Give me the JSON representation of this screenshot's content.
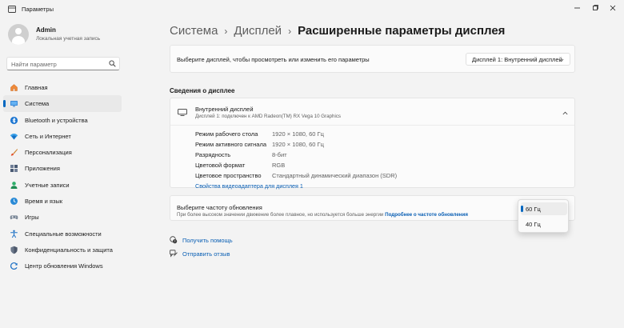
{
  "window": {
    "title": "Параметры",
    "icons": [
      "app-back-icon",
      "minimize-icon",
      "maximize-icon",
      "close-icon"
    ]
  },
  "user": {
    "name": "Admin",
    "account_type": "Локальная учетная запись"
  },
  "search": {
    "placeholder": "Найти параметр"
  },
  "sidebar": {
    "items": [
      {
        "label": "Главная",
        "icon": "home-icon"
      },
      {
        "label": "Система",
        "icon": "system-icon"
      },
      {
        "label": "Bluetooth и устройства",
        "icon": "bluetooth-icon"
      },
      {
        "label": "Сеть и Интернет",
        "icon": "network-icon"
      },
      {
        "label": "Персонализация",
        "icon": "brush-icon"
      },
      {
        "label": "Приложения",
        "icon": "apps-icon"
      },
      {
        "label": "Учетные записи",
        "icon": "accounts-icon"
      },
      {
        "label": "Время и язык",
        "icon": "globe-clock-icon"
      },
      {
        "label": "Игры",
        "icon": "gamepad-icon"
      },
      {
        "label": "Специальные возможности",
        "icon": "accessibility-icon"
      },
      {
        "label": "Конфиденциальность и защита",
        "icon": "shield-icon"
      },
      {
        "label": "Центр обновления Windows",
        "icon": "update-icon"
      }
    ],
    "selected": "Система"
  },
  "breadcrumb": {
    "items": [
      "Система",
      "Дисплей",
      "Расширенные параметры дисплея"
    ]
  },
  "display_selector": {
    "label": "Выберите дисплей, чтобы просмотреть или изменить его параметры",
    "value": "Дисплей 1: Внутренний дисплей"
  },
  "display_info": {
    "heading": "Сведения о дисплее",
    "title": "Внутренний дисплей",
    "subtitle": "Дисплей 1: подключен к AMD Radeon(TM) RX Vega 10 Graphics",
    "rows": [
      {
        "key": "Режим рабочего стола",
        "value": "1920 × 1080, 60 Гц"
      },
      {
        "key": "Режим активного сигнала",
        "value": "1920 × 1080, 60 Гц"
      },
      {
        "key": "Разрядность",
        "value": "8-бит"
      },
      {
        "key": "Цветовой формат",
        "value": "RGB"
      },
      {
        "key": "Цветовое пространство",
        "value": "Стандартный динамический диапазон (SDR)"
      }
    ],
    "adapter_link": "Свойства видеоадаптера для дисплея 1"
  },
  "refresh": {
    "title": "Выберите частоту обновления",
    "description": "При более высоком значении движение более плавное, но используется больше энергии",
    "more_link": "Подробнее о частоте обновления",
    "options": [
      "60 Гц",
      "40 Гц"
    ],
    "selected": "60 Гц"
  },
  "help_links": {
    "get_help": "Получить помощь",
    "feedback": "Отправить отзыв"
  },
  "colors": {
    "accent": "#0067c0",
    "link": "#0a5fb4"
  }
}
